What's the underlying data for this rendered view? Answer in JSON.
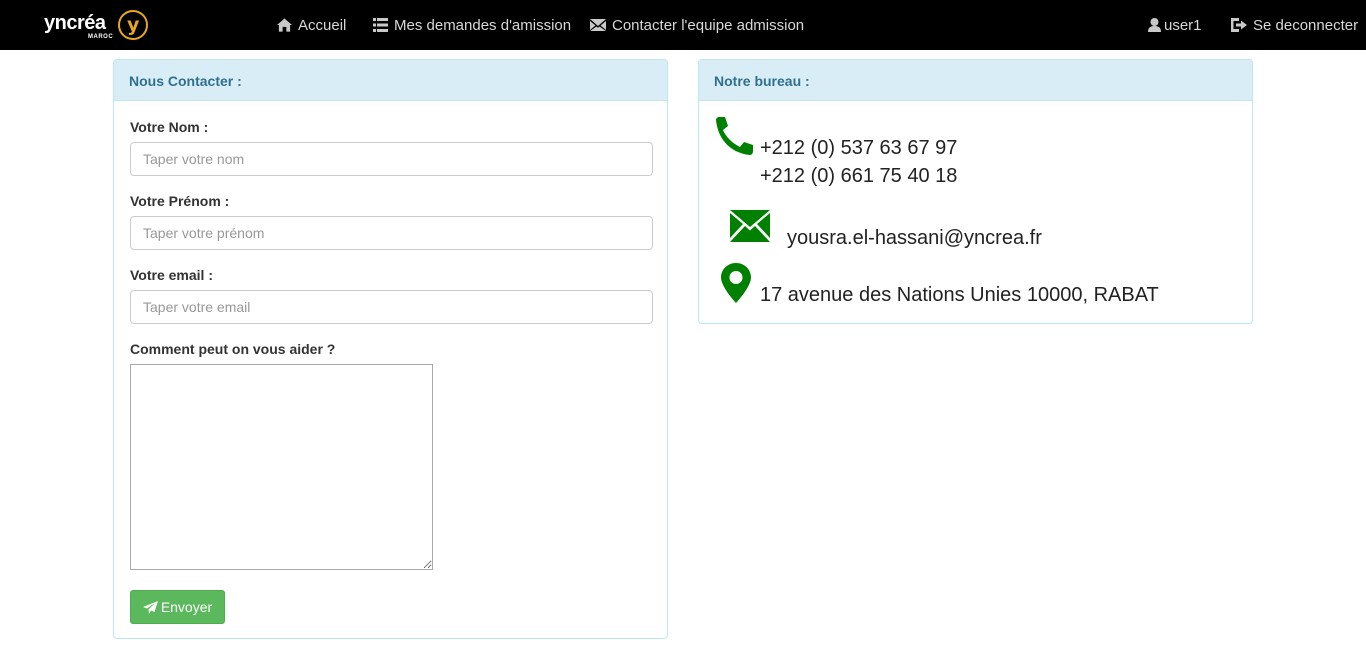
{
  "brand": {
    "name": "yncréa",
    "sub": "MAROC",
    "mark": "y"
  },
  "nav": {
    "home": "Accueil",
    "requests": "Mes demandes d'amission",
    "contact": "Contacter l'equipe admission",
    "user": "user1",
    "logout": "Se deconnecter"
  },
  "contact_form": {
    "title": "Nous Contacter :",
    "name_label": "Votre Nom :",
    "name_placeholder": "Taper votre nom",
    "firstname_label": "Votre Prénom :",
    "firstname_placeholder": "Taper votre prénom",
    "email_label": "Votre email :",
    "email_placeholder": "Taper votre email",
    "message_label": "Comment peut on vous aider ?",
    "message_value": "",
    "submit_label": "Envoyer"
  },
  "office": {
    "title": "Notre bureau :",
    "phone1": "+212 (0) 537 63 67 97",
    "phone2": "+212 (0) 661 75 40 18",
    "email": "yousra.el-hassani@yncrea.fr",
    "address": "17 avenue des Nations Unies 10000, RABAT"
  },
  "icons": {
    "home": "home-icon",
    "list": "list-icon",
    "envelope": "envelope-icon",
    "user": "user-icon",
    "logout": "logout-icon",
    "send": "send-icon",
    "phone": "phone-icon",
    "mail": "mail-icon",
    "location": "map-marker-icon"
  },
  "colors": {
    "navbar": "#000000",
    "panel_heading": "#d9edf7",
    "panel_title": "#31708f",
    "accent_green": "#008000",
    "button": "#5cb85c"
  }
}
